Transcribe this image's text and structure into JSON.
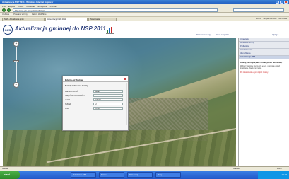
{
  "window": {
    "title": "Aktualizacja NSP 2011 - Windows Internet Explorer"
  },
  "menu": [
    "Plik",
    "Edycja",
    "Widok",
    "Ulubione",
    "Narzędzia",
    "Pomoc"
  ],
  "address": {
    "url": "http://nsp.gis.gov.pl/aktualizacja"
  },
  "favorites": [
    "Ulubione",
    "Polecane witryny",
    "Galeria Web Slice"
  ],
  "tabs": [
    "NSP - Aktualizacja gmin",
    "Aktualizacja NSP 2011",
    "Nowa karta"
  ],
  "commandbar": [
    "Strona",
    "Bezpieczeństwo",
    "Narzędzia"
  ],
  "app": {
    "logo_text": "GUS",
    "title": "Aktualizacja gminnej do NSP 2011",
    "header_links": [
      "Pobierz instrukcję",
      "Pokaż wszystkie",
      "Wyloguj"
    ]
  },
  "map": {
    "brand": "esri",
    "zoom_in": "+",
    "zoom_out": "−"
  },
  "dialog": {
    "title": "Edycja Atrybutów",
    "subtitle": "Punkty Adresowe Gminy",
    "fields": [
      {
        "label": "MIEJSCOWOŚĆ",
        "value": "Rewal"
      },
      {
        "label": "CZĘŚĆ MIEJSCOWOŚCI",
        "value": ""
      },
      {
        "label": "ULICA",
        "value": "Bałtycka"
      },
      {
        "label": "NUMER",
        "value": "12"
      },
      {
        "label": "KOD",
        "value": "72-344"
      }
    ]
  },
  "panel": {
    "sections": [
      "Ustawienia",
      "Adresowe Gminy",
      "Podległość",
      "Aktualizowanie",
      "Identyfikacja",
      "Aktualizacja NSP"
    ],
    "active_section": "Aktualizacja NSP",
    "body_title": "Kliknij na mapie, aby dodać punkt adresowy.",
    "body_text": "Wybierz warstwę i narzędzie edycji, następnie wskaż lokalizację obiektu na mapie.",
    "warning": "Po zakończeniu edycji zapisz zmiany."
  },
  "status": {
    "left": "Gotowe",
    "zone": "Internet",
    "zoom": "100%"
  },
  "taskbar": {
    "start": "start",
    "items": [
      "Aktualizacja NSP",
      "Poczta",
      "Dokumenty",
      "Mapy"
    ],
    "clock": "12:45"
  }
}
